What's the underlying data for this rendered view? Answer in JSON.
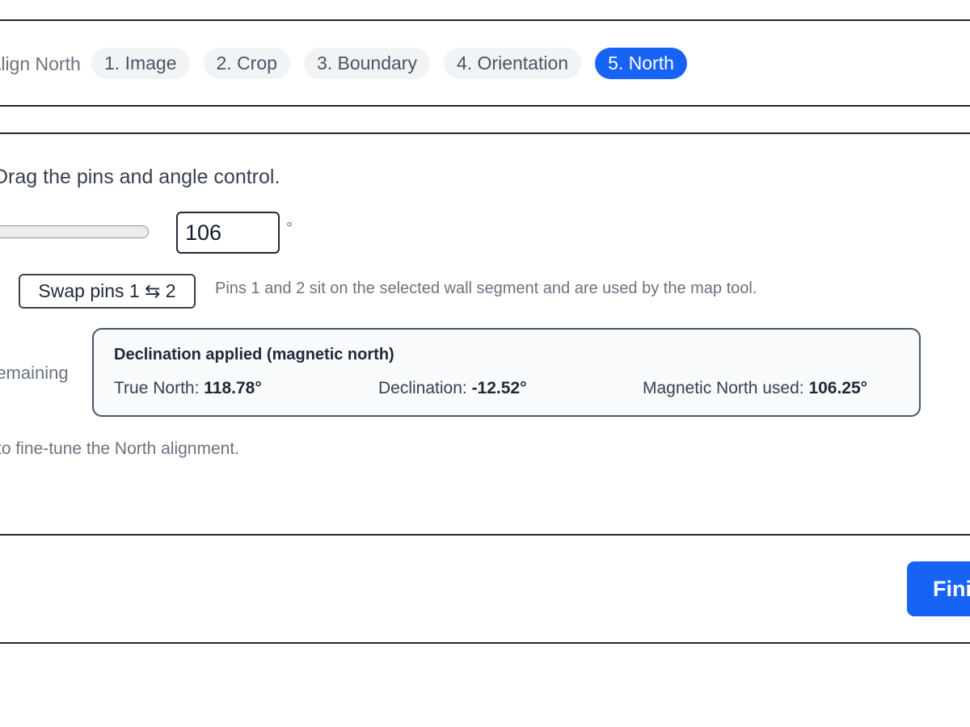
{
  "header": {
    "title": "Align North",
    "steps": [
      {
        "label": "1. Image",
        "active": false
      },
      {
        "label": "2. Crop",
        "active": false
      },
      {
        "label": "3. Boundary",
        "active": false
      },
      {
        "label": "4. Orientation",
        "active": false
      },
      {
        "label": "5. North",
        "active": true
      }
    ]
  },
  "main": {
    "instruction": "Drag the pins and angle control.",
    "angle": {
      "value": "106",
      "unit": "°"
    },
    "swap_button_label": "Swap pins 1 ⇆ 2",
    "swap_help": "Pins 1 and 2 sit on the selected wall segment and are used by the map tool.",
    "remaining_label": "remaining",
    "declination": {
      "title": "Declination applied (magnetic north)",
      "true_north_label": "True North: ",
      "true_north_value": "118.78°",
      "declination_label": "Declination: ",
      "declination_value": "-12.52°",
      "magnetic_label": "Magnetic North used: ",
      "magnetic_value": "106.25°"
    },
    "fine_tune_hint": "to fine-tune the North alignment."
  },
  "footer": {
    "finish_label": "Finish"
  },
  "colors": {
    "accent": "#1763f5",
    "pill_bg": "#f1f3f5",
    "card_bg": "#f8fafc"
  }
}
